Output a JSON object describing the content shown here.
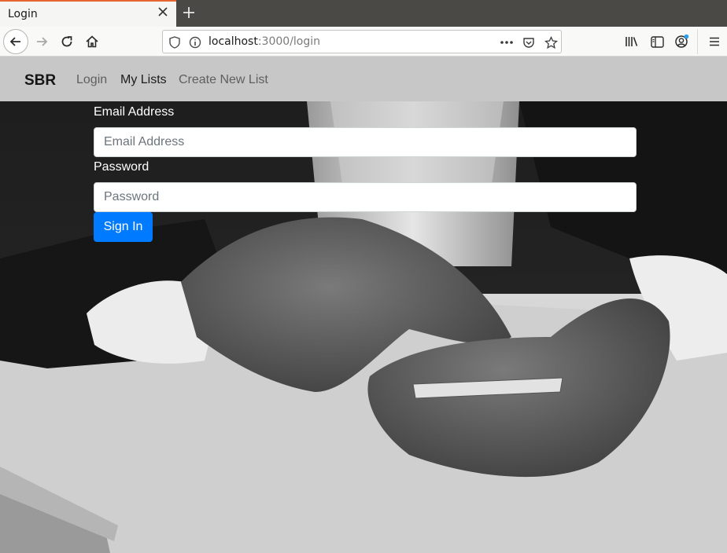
{
  "browser": {
    "tab_title": "Login",
    "url_host": "localhost",
    "url_path": ":3000/login"
  },
  "app_nav": {
    "brand": "SBR",
    "links": [
      "Login",
      "My Lists",
      "Create New List"
    ]
  },
  "login_form": {
    "email_label": "Email Address",
    "email_placeholder": "Email Address",
    "password_label": "Password",
    "password_placeholder": "Password",
    "submit_label": "Sign In"
  },
  "colors": {
    "primary_button": "#007bff",
    "nav_background": "#c7c7c7",
    "tab_accent": "#e66532"
  }
}
